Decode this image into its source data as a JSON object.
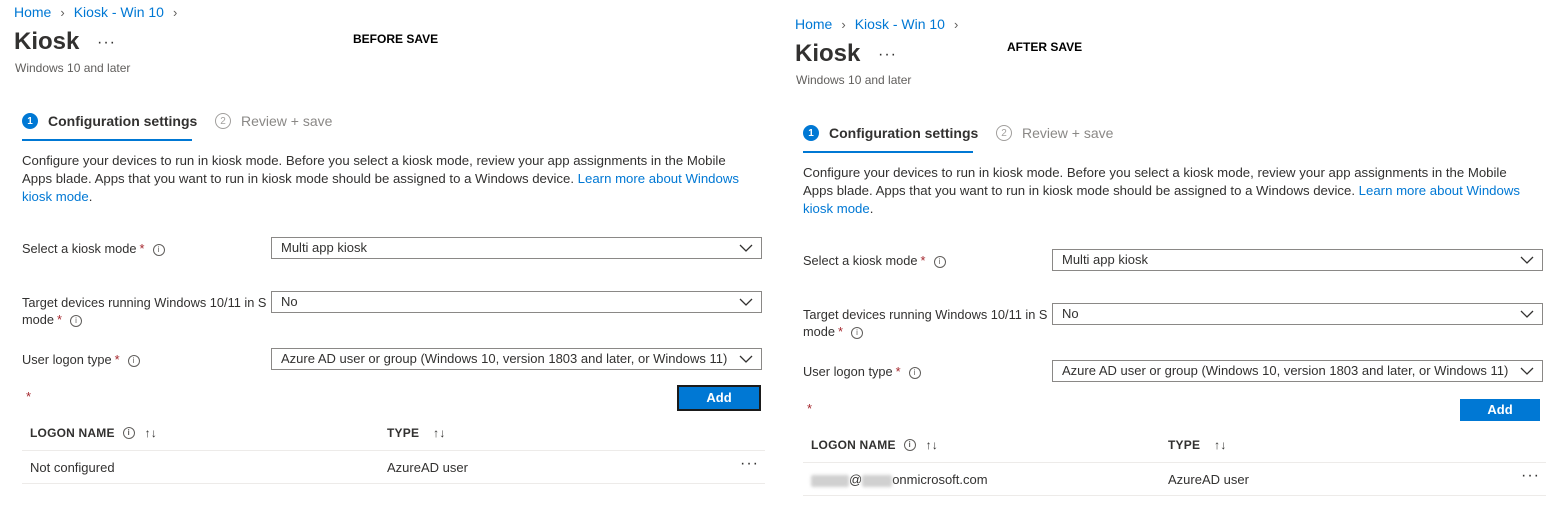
{
  "before": {
    "breadcrumb": [
      "Home",
      "Kiosk - Win 10"
    ],
    "title": "Kiosk",
    "more": "···",
    "subtitle": "Windows 10 and later",
    "stage_label": "BEFORE SAVE",
    "steps": [
      {
        "num": "1",
        "label": "Configuration settings"
      },
      {
        "num": "2",
        "label": "Review + save"
      }
    ],
    "description": "Configure your devices to run in kiosk mode. Before you select a kiosk mode, review your app assignments in the Mobile Apps blade. Apps that you want to run in kiosk mode should be assigned to a Windows device. ",
    "learn_more": "Learn more about Windows kiosk mode",
    "kiosk_mode_label": "Select a kiosk mode",
    "kiosk_mode_value": "Multi app kiosk",
    "s_mode_label": "Target devices running Windows 10/11 in S mode",
    "s_mode_value": "No",
    "logon_type_label": "User logon type",
    "logon_type_value": "Azure AD user or group (Windows 10, version 1803 and later, or Windows 11)",
    "required_star": "*",
    "add_label": "Add",
    "col_logon": "LOGON NAME",
    "col_type": "TYPE",
    "rows": [
      {
        "logon": "Not configured",
        "type": "AzureAD user"
      }
    ],
    "row_more": "···"
  },
  "after": {
    "breadcrumb": [
      "Home",
      "Kiosk - Win 10"
    ],
    "title": "Kiosk",
    "more": "···",
    "subtitle": "Windows 10 and later",
    "stage_label": "AFTER SAVE",
    "steps": [
      {
        "num": "1",
        "label": "Configuration settings"
      },
      {
        "num": "2",
        "label": "Review + save"
      }
    ],
    "description": "Configure your devices to run in kiosk mode. Before you select a kiosk mode, review your app assignments in the Mobile Apps blade. Apps that you want to run in kiosk mode should be assigned to a Windows device. ",
    "learn_more": "Learn more about Windows kiosk mode",
    "kiosk_mode_label": "Select a kiosk mode",
    "kiosk_mode_value": "Multi app kiosk",
    "s_mode_label": "Target devices running Windows 10/11 in S mode",
    "s_mode_value": "No",
    "logon_type_label": "User logon type",
    "logon_type_value": "Azure AD user or group (Windows 10, version 1803 and later, or Windows 11)",
    "required_star": "*",
    "add_label": "Add",
    "col_logon": "LOGON NAME",
    "col_type": "TYPE",
    "rows": [
      {
        "logon_visible": "@",
        "logon_domain": "onmicrosoft.com",
        "type": "AzureAD user"
      }
    ],
    "row_more": "···"
  },
  "icons": {
    "info": "info-icon",
    "chevron": "chevron-down-icon",
    "sort": "sort-icon",
    "breadcrumb_sep": "chevron-right-icon"
  },
  "colors": {
    "accent": "#0078d4",
    "required": "#a4262c"
  }
}
